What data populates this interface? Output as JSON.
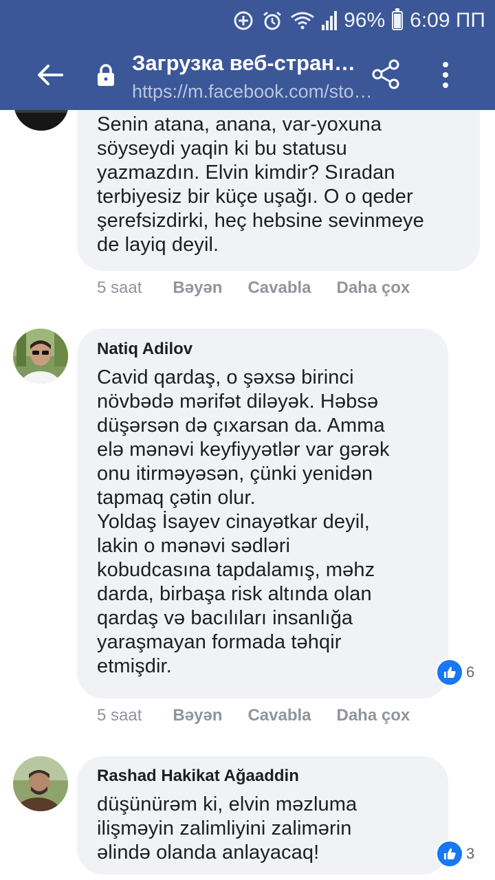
{
  "status_bar": {
    "battery": "96%",
    "time": "6:09 ПП"
  },
  "browser": {
    "title": "Загрузка веб-стран…",
    "url": "https://m.facebook.com/sto…"
  },
  "comments": [
    {
      "author": "",
      "text": "Senin atana, anana, var-yoxuna\nsöyseydi yaqin ki bu statusu\nyazmazdın. Elvin kimdir? Sıradan\nterbiyesiz bir küçe uşağı. O o qeder\nşerefsizdirki, heç hebsine sevinmeye\nde layiq deyil.",
      "time": "5 saat",
      "like_label": "Bəyən",
      "reply_label": "Cavabla",
      "more_label": "Daha çox"
    },
    {
      "author": "Natiq Adilov",
      "text": "Cavid qardaş, o şəxsə birinci\nnövbədə mərifət diləyək. Həbsə\ndüşərsən də çıxarsan da. Amma\nelə mənəvi keyfiyyətlər var gərək\nonu itirməyəsən, çünki yenidən\ntapmaq çətin olur.\nYoldaş İsayev cinayətkar deyil,\nlakin o mənəvi sədləri\nkobudcasına tapdalamış, məhz\ndarda, birbaşa risk altında olan\nqardaş və bacılıları insanlığa\nyaraşmayan formada təhqir\netmişdir.",
      "reactions": "6",
      "time": "5 saat",
      "like_label": "Bəyən",
      "reply_label": "Cavabla",
      "more_label": "Daha çox"
    },
    {
      "author": "Rashad Hakikat Ağaaddin",
      "text": "düşünürəm ki, elvin məzluma\nilişməyin zalimliyini zalimərin\nəlində olanda anlayacaq!",
      "reactions": "3"
    }
  ],
  "colors": {
    "header": "#3b5798",
    "bubble": "#f0f2f5",
    "like_blue": "#1877f2"
  }
}
